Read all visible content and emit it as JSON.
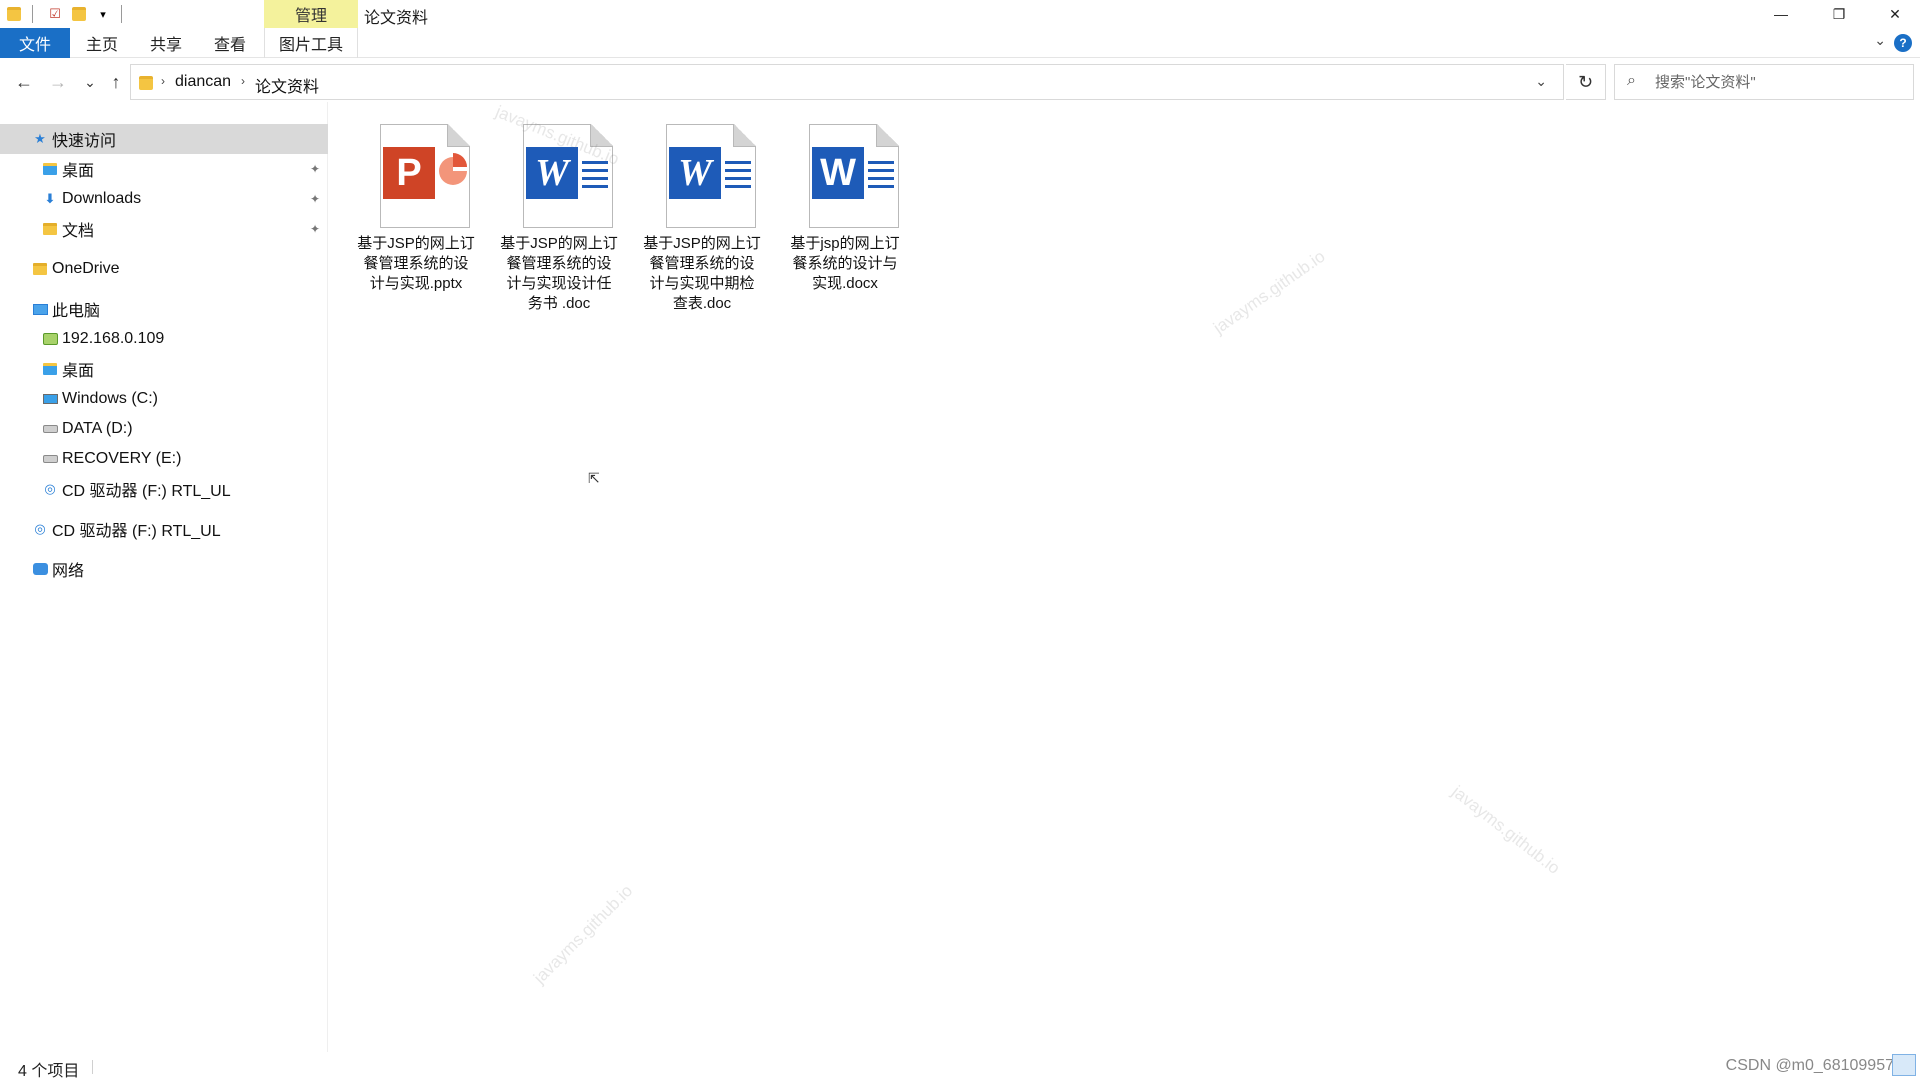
{
  "window": {
    "title": "论文资料",
    "context_tab_group": "管理",
    "controls": {
      "minimize": "—",
      "restore": "❐",
      "close": "✕"
    }
  },
  "ribbon": {
    "tabs": [
      {
        "label": "文件",
        "active": true
      },
      {
        "label": "主页"
      },
      {
        "label": "共享"
      },
      {
        "label": "查看"
      },
      {
        "label": "图片工具"
      }
    ],
    "expand_icon": "chevron-down",
    "help": "?"
  },
  "nav": {
    "back": "←",
    "forward": "→",
    "recent": "⌄",
    "up": "↑"
  },
  "address": {
    "crumbs": [
      "diancan",
      "论文资料"
    ],
    "refresh": "↻"
  },
  "search": {
    "placeholder": "搜索\"论文资料\"",
    "value": ""
  },
  "sidebar": {
    "items": [
      {
        "label": "快速访问",
        "icon": "star-icon",
        "selected": true
      },
      {
        "label": "桌面",
        "icon": "desktop-folder-icon",
        "pinned": true
      },
      {
        "label": "Downloads",
        "icon": "downloads-folder-icon",
        "pinned": true
      },
      {
        "label": "文档",
        "icon": "documents-folder-icon",
        "pinned": true
      },
      {
        "label": "OneDrive",
        "icon": "onedrive-folder-icon"
      },
      {
        "label": "此电脑",
        "icon": "computer-icon"
      },
      {
        "label": "192.168.0.109",
        "icon": "network-drive-icon"
      },
      {
        "label": "桌面",
        "icon": "desktop-folder-icon"
      },
      {
        "label": "Windows (C:)",
        "icon": "windows-drive-icon"
      },
      {
        "label": "DATA (D:)",
        "icon": "drive-icon"
      },
      {
        "label": "RECOVERY (E:)",
        "icon": "drive-icon"
      },
      {
        "label": "CD 驱动器 (F:) RTL_UL",
        "icon": "cd-drive-icon"
      },
      {
        "label": "CD 驱动器 (F:) RTL_UL",
        "icon": "cd-drive-icon"
      },
      {
        "label": "网络",
        "icon": "network-icon"
      }
    ],
    "pin_glyph": "📌"
  },
  "files": [
    {
      "name": "基于JSP的网上订餐管理系统的设计与实现.pptx",
      "lines": [
        "基于JSP的网上订",
        "餐管理系统的设",
        "计与实现.pptx"
      ],
      "type": "pptx",
      "badge": "P"
    },
    {
      "name": "基于JSP的网上订餐管理系统的设计与实现设计任务书 .doc",
      "lines": [
        "基于JSP的网上订",
        "餐管理系统的设",
        "计与实现设计任",
        "务书 .doc"
      ],
      "type": "doc",
      "badge": "W"
    },
    {
      "name": "基于JSP的网上订餐管理系统的设计与实现中期检查表.doc",
      "lines": [
        "基于JSP的网上订",
        "餐管理系统的设",
        "计与实现中期检",
        "查表.doc"
      ],
      "type": "doc",
      "badge": "W"
    },
    {
      "name": "基于jsp的网上订餐系统的设计与实现.docx",
      "lines": [
        "基于jsp的网上订",
        "餐系统的设计与",
        "实现.docx"
      ],
      "type": "docx",
      "badge": "W"
    }
  ],
  "watermark": "javayms.github.io",
  "status": {
    "item_count": "4 个项目",
    "csdn_credit": "CSDN @m0_68109957"
  },
  "colors": {
    "accent": "#1a6fc6",
    "manage_tab": "#f4f29c",
    "ppt": "#cf4426",
    "word": "#1e5bb8",
    "selected_nav": "#d9d9d9"
  }
}
